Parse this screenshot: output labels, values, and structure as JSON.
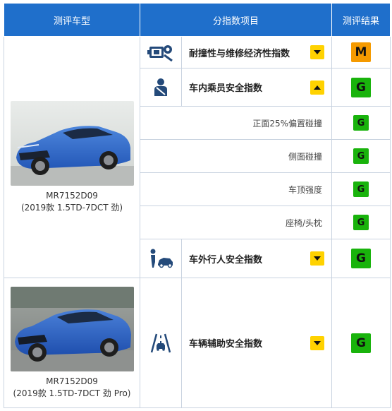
{
  "header": {
    "col_vehicle": "测评车型",
    "col_index": "分指数项目",
    "col_result": "测评结果"
  },
  "vehicles": [
    {
      "model": "MR7152D09",
      "spec": "(2019款 1.5TD-7DCT 劲)"
    },
    {
      "model": "MR7152D09",
      "spec": "(2019款 1.5TD-7DCT 劲 Pro)"
    }
  ],
  "rows": {
    "durability": {
      "label": "耐撞性与维修经济性指数",
      "result": "M",
      "icon": "repair-engine-icon"
    },
    "occupant": {
      "label": "车内乘员安全指数",
      "result": "G",
      "icon": "seated-occupant-icon"
    },
    "frontal": {
      "label": "正面25%偏置碰撞",
      "result": "G"
    },
    "side": {
      "label": "侧面碰撞",
      "result": "G"
    },
    "roof": {
      "label": "车顶强度",
      "result": "G"
    },
    "seat": {
      "label": "座椅/头枕",
      "result": "G"
    },
    "pedestrian": {
      "label": "车外行人安全指数",
      "result": "G",
      "icon": "pedestrian-car-icon"
    },
    "assist": {
      "label": "车辆辅助安全指数",
      "result": "G",
      "icon": "driver-assist-road-icon"
    }
  },
  "colors": {
    "header_bg": "#1f6fcb",
    "grade_G": "#19b30c",
    "grade_M": "#f59a00",
    "toggle": "#ffd200",
    "car_body": "#2e69c9"
  }
}
